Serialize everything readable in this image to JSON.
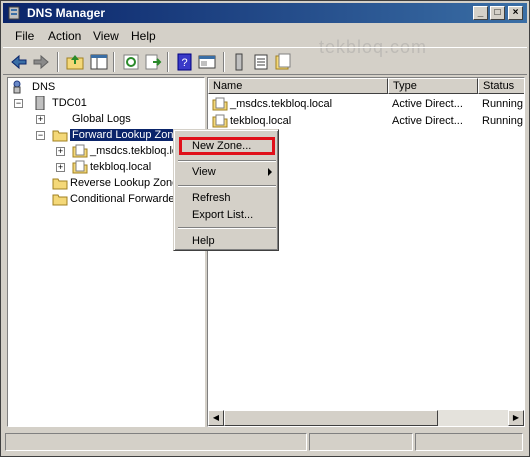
{
  "window": {
    "title": "DNS Manager"
  },
  "watermark": "tekbloq.com",
  "menu": [
    "File",
    "Action",
    "View",
    "Help"
  ],
  "toolbar": {
    "buttons": [
      "back-icon",
      "forward-icon",
      "up-folder-icon",
      "show-hide-tree-icon",
      "refresh-icon",
      "export-list-icon",
      "help-icon",
      "properties-icon",
      "server-icon",
      "list-icon",
      "zone-icon"
    ]
  },
  "tree": {
    "root": "DNS",
    "server": "TDC01",
    "global_logs": "Global Logs",
    "forward_zones": "Forward Lookup Zones",
    "msdcs_zone": "_msdcs.tekbloq.local",
    "tekbloq_zone": "tekbloq.local",
    "reverse_zones": "Reverse Lookup Zones",
    "conditional_forwarders": "Conditional Forwarders"
  },
  "list": {
    "columns": [
      "Name",
      "Type",
      "Status"
    ],
    "rows": [
      {
        "name": "_msdcs.tekbloq.local",
        "type": "Active Direct...",
        "status": "Running"
      },
      {
        "name": "tekbloq.local",
        "type": "Active Direct...",
        "status": "Running"
      }
    ]
  },
  "context_menu": {
    "new_zone": "New Zone...",
    "view": "View",
    "refresh": "Refresh",
    "export_list": "Export List...",
    "help": "Help",
    "highlight_color": "#e0101a"
  },
  "colors": {
    "selection": "#0a246a",
    "titlebar_start": "#0a246a",
    "titlebar_end": "#3a6ea5",
    "folder": "#f4d878"
  }
}
